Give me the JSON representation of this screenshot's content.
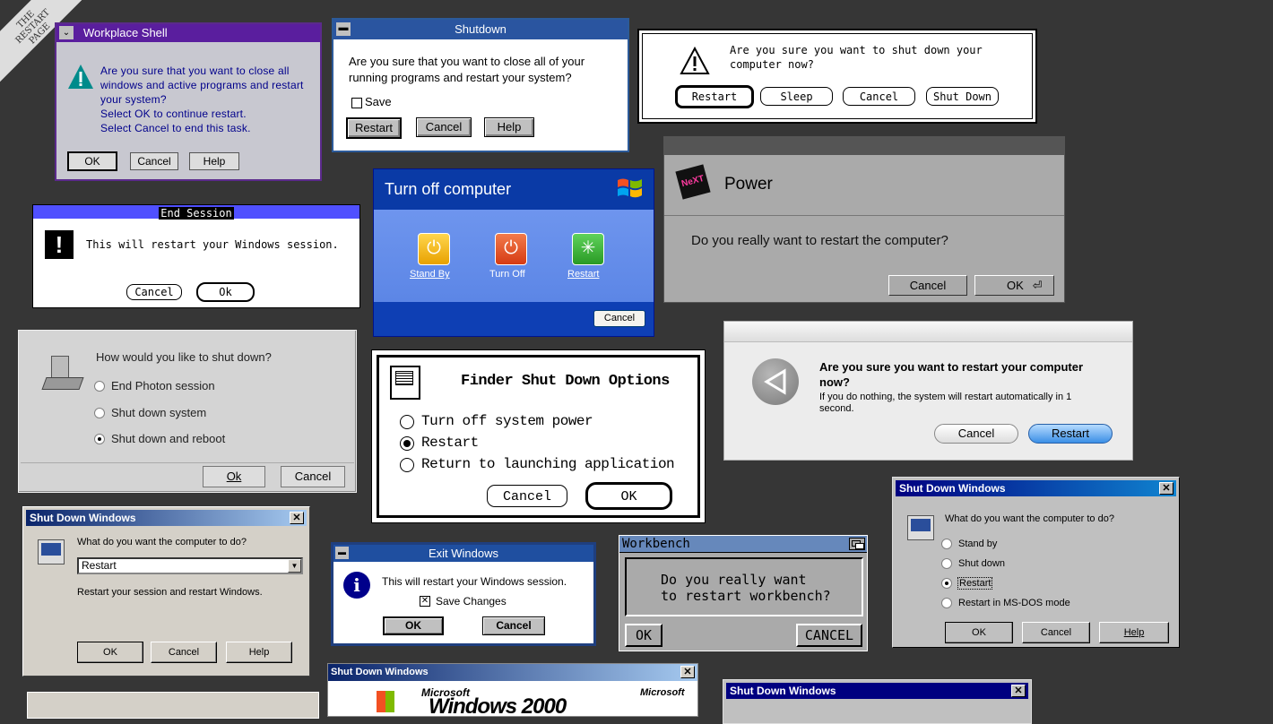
{
  "corner": {
    "label": "THE RESTART PAGE"
  },
  "os2": {
    "title": "Workplace Shell",
    "message": "Are you sure that you want to close all windows and active programs and restart your system?\nSelect OK to continue restart.\nSelect Cancel to end this task.",
    "ok": "OK",
    "cancel": "Cancel",
    "help": "Help"
  },
  "win31": {
    "title": "Shutdown",
    "message": "Are you sure that you want to close all of your running programs and restart your system?",
    "save": "Save",
    "restart": "Restart",
    "cancel": "Cancel",
    "help": "Help"
  },
  "mac": {
    "message": "Are you sure you want to shut down your computer now?",
    "restart": "Restart",
    "sleep": "Sleep",
    "cancel": "Cancel",
    "shutdown": "Shut Down"
  },
  "endsession": {
    "title": "End Session",
    "message": "This will restart your Windows session.",
    "cancel": "Cancel",
    "ok": "Ok"
  },
  "xp": {
    "title": "Turn off computer",
    "standby": "Stand By",
    "turnoff": "Turn Off",
    "restart": "Restart",
    "cancel": "Cancel"
  },
  "next": {
    "title": "Power",
    "message": "Do you really want to restart the computer?",
    "cancel": "Cancel",
    "ok": "OK"
  },
  "photon": {
    "question": "How would you like to shut down?",
    "options": [
      "End Photon session",
      "Shut down system",
      "Shut down and reboot"
    ],
    "ok": "Ok",
    "cancel": "Cancel"
  },
  "finder": {
    "title": "Finder Shut Down Options",
    "options": [
      "Turn off system power",
      "Restart",
      "Return to launching application"
    ],
    "cancel": "Cancel",
    "ok": "OK"
  },
  "aqua": {
    "heading": "Are you sure you want to restart your computer now?",
    "sub": "If you do nothing, the system will restart automatically in 1 second.",
    "cancel": "Cancel",
    "restart": "Restart"
  },
  "w95": {
    "title": "Shut Down Windows",
    "question": "What do you want the computer to do?",
    "options": [
      "Stand by",
      "Shut down",
      "Restart",
      "Restart in MS-DOS mode"
    ],
    "ok": "OK",
    "cancel": "Cancel",
    "help": "Help"
  },
  "w98": {
    "title": "Shut Down Windows",
    "question": "What do you want the computer to do?",
    "selected": "Restart",
    "desc": "Restart your session and restart Windows.",
    "ok": "OK",
    "cancel": "Cancel",
    "help": "Help"
  },
  "exitwin": {
    "title": "Exit Windows",
    "message": "This will restart your Windows session.",
    "save": "Save Changes",
    "ok": "OK",
    "cancel": "Cancel"
  },
  "amiga": {
    "title": "Workbench",
    "message": "Do you really want\nto restart workbench?",
    "ok": "OK",
    "cancel": "CANCEL"
  },
  "w2k": {
    "title": "Shut Down Windows",
    "microsoft": "Microsoft",
    "brand": "Microsoft",
    "windows": "Windows 2000"
  },
  "w95b": {
    "title": "Shut Down Windows"
  }
}
